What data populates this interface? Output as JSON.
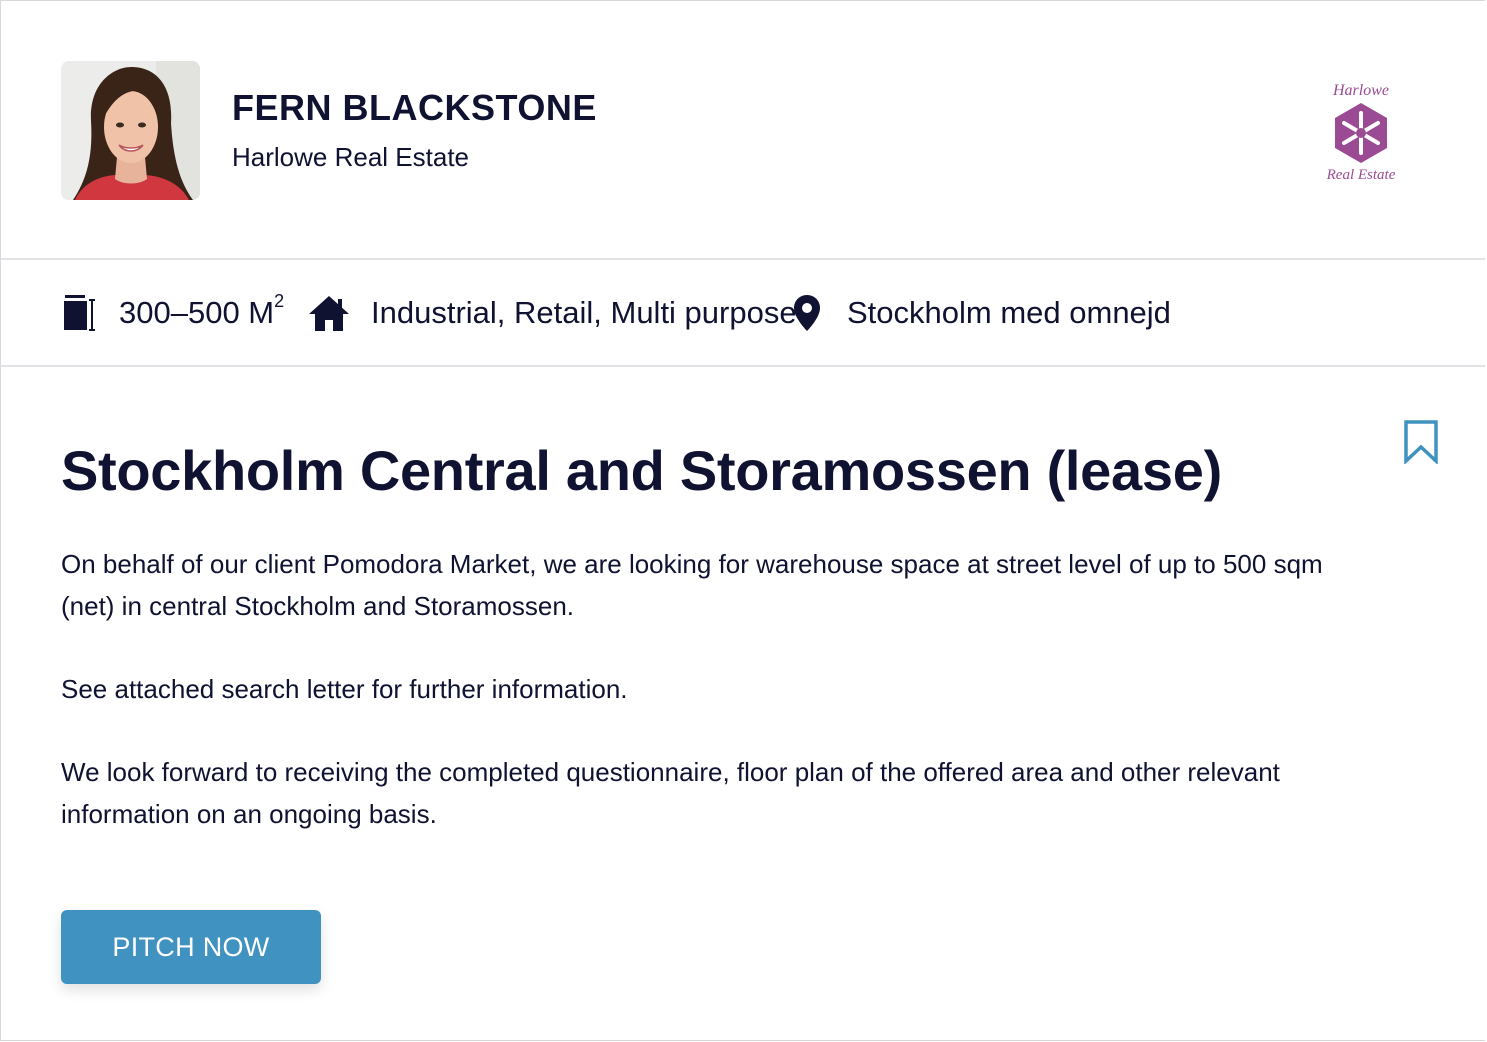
{
  "agent": {
    "name": "FERN BLACKSTONE",
    "company": "Harlowe Real Estate"
  },
  "company_logo": {
    "text_top": "Harlowe",
    "text_bottom": "Real Estate",
    "color": "#9b4b93"
  },
  "meta": {
    "size": "300–500 M",
    "size_unit_sup": "2",
    "size_icon": "building-size-icon",
    "type": "Industrial, Retail, Multi purpose",
    "type_icon": "home-icon",
    "location": "Stockholm med omnejd",
    "location_icon": "location-pin-icon"
  },
  "listing": {
    "title": "Stockholm Central and Storamossen (lease)",
    "paragraphs": [
      "On behalf of our client Pomodora Market, we are looking for warehouse space at street level of up to 500 sqm (net) in central Stockholm and Storamossen.",
      "See attached search letter for further information.",
      "We look forward to receiving the completed questionnaire, floor plan of the offered area and other relevant information on an ongoing basis."
    ],
    "bookmark_icon": "bookmark-icon"
  },
  "actions": {
    "pitch_label": "PITCH NOW"
  },
  "colors": {
    "text": "#0f1230",
    "accent": "#4092c1",
    "divider": "#e1e3e6",
    "logo": "#9b4b93"
  }
}
